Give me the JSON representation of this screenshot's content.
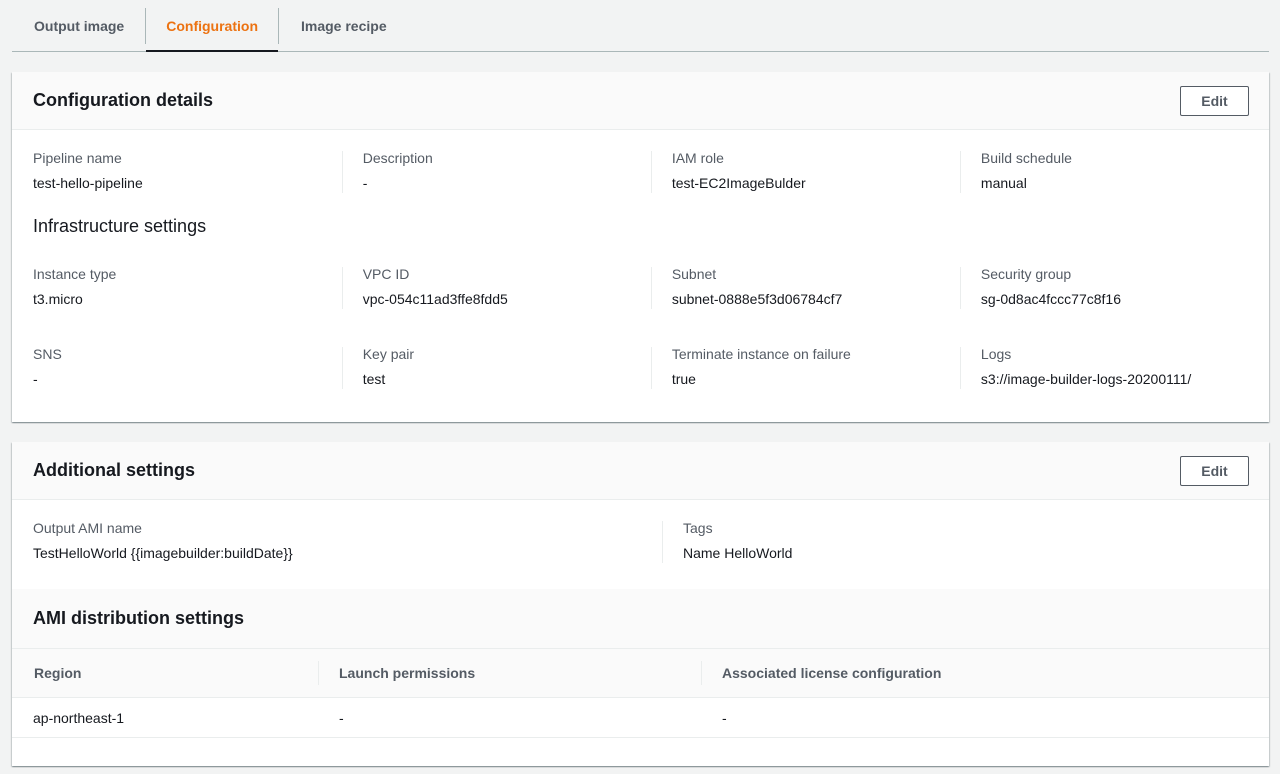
{
  "tabs": [
    {
      "label": "Output image",
      "active": false
    },
    {
      "label": "Configuration",
      "active": true
    },
    {
      "label": "Image recipe",
      "active": false
    }
  ],
  "config": {
    "title": "Configuration details",
    "edit_label": "Edit",
    "pipeline_name_label": "Pipeline name",
    "pipeline_name": "test-hello-pipeline",
    "description_label": "Description",
    "description": "-",
    "iam_role_label": "IAM role",
    "iam_role": "test-EC2ImageBulder",
    "build_schedule_label": "Build schedule",
    "build_schedule": "manual",
    "infra_heading": "Infrastructure settings",
    "instance_type_label": "Instance type",
    "instance_type": "t3.micro",
    "vpc_id_label": "VPC ID",
    "vpc_id": "vpc-054c11ad3ffe8fdd5",
    "subnet_label": "Subnet",
    "subnet": "subnet-0888e5f3d06784cf7",
    "security_group_label": "Security group",
    "security_group": "sg-0d8ac4fccc77c8f16",
    "sns_label": "SNS",
    "sns": "-",
    "key_pair_label": "Key pair",
    "key_pair": "test",
    "terminate_label": "Terminate instance on failure",
    "terminate": "true",
    "logs_label": "Logs",
    "logs": "s3://image-builder-logs-20200111/"
  },
  "additional": {
    "title": "Additional settings",
    "edit_label": "Edit",
    "ami_name_label": "Output AMI name",
    "ami_name": "TestHelloWorld {{imagebuilder:buildDate}}",
    "tags_label": "Tags",
    "tags": "Name HelloWorld",
    "distribution_heading": "AMI distribution settings",
    "table": {
      "columns": [
        "Region",
        "Launch permissions",
        "Associated license configuration"
      ],
      "rows": [
        [
          "ap-northeast-1",
          "-",
          "-"
        ]
      ]
    }
  }
}
